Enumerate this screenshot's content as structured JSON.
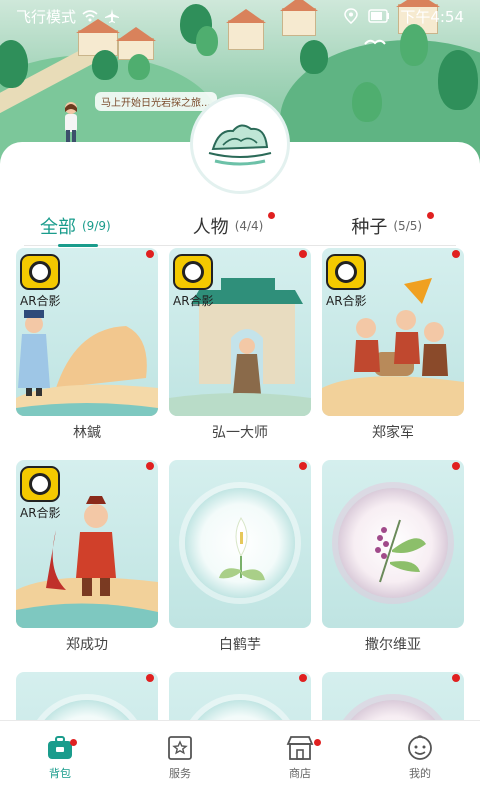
{
  "status_bar": {
    "mode": "飞行模式",
    "time": "下午4:54"
  },
  "hero": {
    "speech": "马上开始日光岩探之旅..."
  },
  "tabs": [
    {
      "label": "全部",
      "count": "(9/9)",
      "active": true,
      "new": false
    },
    {
      "label": "人物",
      "count": "(4/4)",
      "active": false,
      "new": true
    },
    {
      "label": "种子",
      "count": "(5/5)",
      "active": false,
      "new": true
    }
  ],
  "cards": [
    {
      "name": "林鍼",
      "ar": true,
      "ar_label": "AR合影",
      "kind": "figure",
      "new": true
    },
    {
      "name": "弘一大师",
      "ar": true,
      "ar_label": "AR合影",
      "kind": "figure",
      "new": true
    },
    {
      "name": "郑家军",
      "ar": true,
      "ar_label": "AR合影",
      "kind": "figure",
      "new": true
    },
    {
      "name": "郑成功",
      "ar": true,
      "ar_label": "AR合影",
      "kind": "figure",
      "new": true
    },
    {
      "name": "白鹤芋",
      "ar": false,
      "kind": "plant",
      "new": true
    },
    {
      "name": "撒尔维亚",
      "ar": false,
      "kind": "plant",
      "new": true
    },
    {
      "name": "",
      "ar": false,
      "kind": "plant",
      "new": true
    },
    {
      "name": "",
      "ar": false,
      "kind": "plant",
      "new": true
    },
    {
      "name": "",
      "ar": false,
      "kind": "plant",
      "new": true
    }
  ],
  "nav": [
    {
      "label": "背包",
      "icon": "backpack-icon",
      "active": true,
      "new": true
    },
    {
      "label": "服务",
      "icon": "service-icon",
      "active": false,
      "new": false
    },
    {
      "label": "商店",
      "icon": "shop-icon",
      "active": false,
      "new": true
    },
    {
      "label": "我的",
      "icon": "profile-icon",
      "active": false,
      "new": false
    }
  ],
  "colors": {
    "accent": "#1a9c8c",
    "badge": "#e02020"
  }
}
